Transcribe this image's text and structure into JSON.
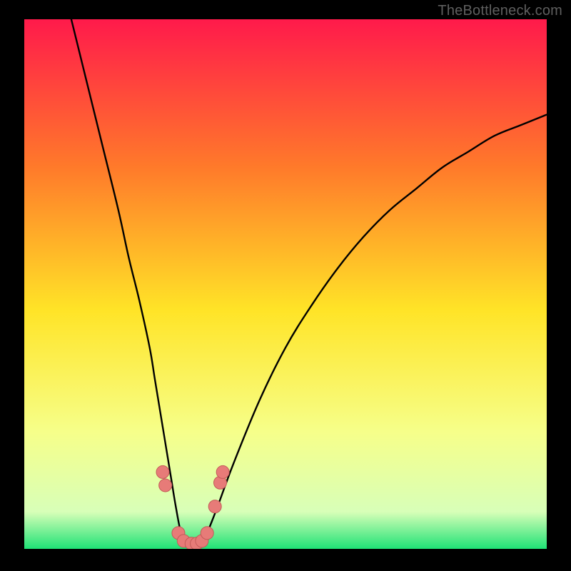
{
  "watermark": "TheBottleneck.com",
  "colors": {
    "frame": "#000000",
    "gradient_top": "#ff1a4b",
    "gradient_upper_mid": "#ff7a2a",
    "gradient_mid": "#ffe427",
    "gradient_lower_mid": "#f6ff8a",
    "gradient_low": "#d8ffb8",
    "gradient_bottom": "#1fe276",
    "curve": "#000000",
    "marker_fill": "#e77b78",
    "marker_stroke": "#c35a58"
  },
  "chart_data": {
    "type": "line",
    "title": "",
    "xlabel": "",
    "ylabel": "",
    "xlim": [
      0,
      100
    ],
    "ylim": [
      0,
      100
    ],
    "note": "Axes are unlabeled; values below are normalized 0–100 estimates read from pixel positions. y=0 is the bottom green band, y=100 is the top.",
    "series": [
      {
        "name": "curve",
        "x": [
          9,
          12,
          15,
          18,
          20,
          22,
          24,
          25,
          26,
          27,
          28,
          29,
          30,
          31,
          32,
          33,
          34,
          35,
          37,
          40,
          45,
          50,
          55,
          60,
          65,
          70,
          75,
          80,
          85,
          90,
          95,
          100
        ],
        "y": [
          100,
          88,
          76,
          64,
          55,
          47,
          38,
          32,
          26,
          20,
          14,
          8,
          3,
          1,
          0,
          0,
          1,
          3,
          8,
          16,
          28,
          38,
          46,
          53,
          59,
          64,
          68,
          72,
          75,
          78,
          80,
          82
        ]
      }
    ],
    "markers": [
      {
        "x": 26.5,
        "y": 14.5
      },
      {
        "x": 27.0,
        "y": 12.0
      },
      {
        "x": 29.5,
        "y": 3.0
      },
      {
        "x": 30.5,
        "y": 1.5
      },
      {
        "x": 32.0,
        "y": 1.0
      },
      {
        "x": 33.0,
        "y": 1.0
      },
      {
        "x": 34.0,
        "y": 1.5
      },
      {
        "x": 35.0,
        "y": 3.0
      },
      {
        "x": 36.5,
        "y": 8.0
      },
      {
        "x": 37.5,
        "y": 12.5
      },
      {
        "x": 38.0,
        "y": 14.5
      }
    ]
  }
}
